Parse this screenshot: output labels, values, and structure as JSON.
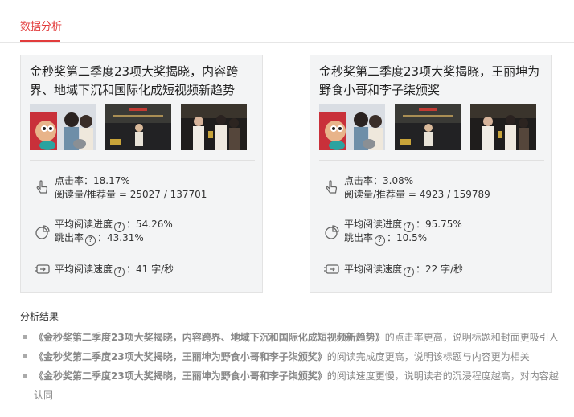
{
  "tabs": {
    "active": "数据分析"
  },
  "cards": [
    {
      "title": "金秒奖第二季度23项大奖揭晓，内容跨界、地域下沉和国际化成短视频新趋势",
      "click_rate": "点击率：18.17%",
      "read_recommend": "阅读量/推荐量 = 25027 / 137701",
      "avg_progress_label": "平均阅读进度",
      "avg_progress_value": "：54.26%",
      "bounce_label": "跳出率",
      "bounce_value": "：43.31%",
      "avg_speed_label": "平均阅读速度",
      "avg_speed_value": "：41 字/秒"
    },
    {
      "title": "金秒奖第二季度23项大奖揭晓，王丽坤为野食小哥和李子柒颁奖",
      "click_rate": "点击率：3.08%",
      "read_recommend": "阅读量/推荐量 = 4923 / 159789",
      "avg_progress_label": "平均阅读进度",
      "avg_progress_value": "：95.75%",
      "bounce_label": "跳出率",
      "bounce_value": "：10.5%",
      "avg_speed_label": "平均阅读速度",
      "avg_speed_value": "：22 字/秒"
    }
  ],
  "analysis": {
    "title": "分析结果",
    "items": [
      {
        "bold": "《金秒奖第二季度23项大奖揭晓，内容跨界、地域下沉和国际化成短视频新趋势》",
        "text": "的点击率更高，说明标题和封面更吸引人"
      },
      {
        "bold": "《金秒奖第二季度23项大奖揭晓，王丽坤为野食小哥和李子柒颁奖》",
        "text": "的阅读完成度更高，说明该标题与内容更为相关"
      },
      {
        "bold": "《金秒奖第二季度23项大奖揭晓，王丽坤为野食小哥和李子柒颁奖》",
        "text": "的阅读速度更慢，说明读者的沉浸程度越高，对内容越认同"
      }
    ]
  }
}
